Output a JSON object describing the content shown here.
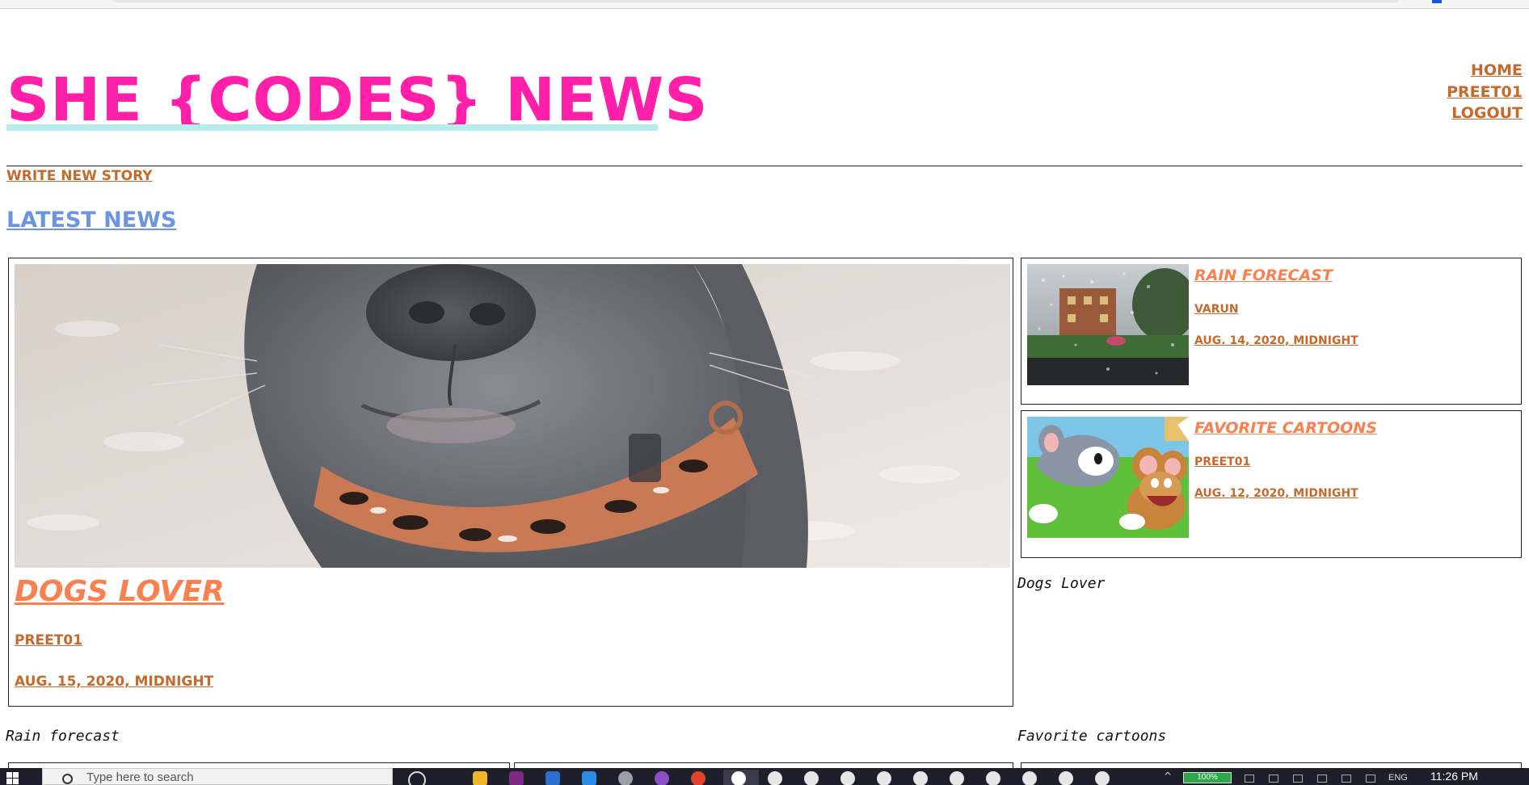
{
  "site": {
    "title": "SHE {CODES} NEWS"
  },
  "nav": {
    "home": "HOME",
    "user": "PREET01",
    "logout": "LOGOUT"
  },
  "actions": {
    "write_story": "WRITE NEW STORY"
  },
  "latest": {
    "heading": "LATEST NEWS"
  },
  "featured": {
    "title": "DOGS LOVER",
    "author": "PREET01",
    "date": "AUG. 15, 2020, MIDNIGHT",
    "image_icon": "dog-photo"
  },
  "stories": [
    {
      "title": "RAIN FORECAST",
      "author": "VARUN",
      "date": "AUG. 14, 2020, MIDNIGHT",
      "image_icon": "rain-window-photo"
    },
    {
      "title": "FAVORITE CARTOONS",
      "author": "PREET01",
      "date": "AUG. 12, 2020, MIDNIGHT",
      "image_icon": "tom-and-jerry-image"
    }
  ],
  "captions": {
    "dogs": "Dogs Lover",
    "rain": "Rain forecast",
    "cartoons": "Favorite cartoons"
  },
  "taskbar": {
    "search_placeholder": "Type here to search",
    "time": "11:26 PM",
    "language": "ENG",
    "battery_label": "100%"
  },
  "colors": {
    "brand_pink": "#ff1fa8",
    "title_highlight": "#b8ecec",
    "link_orange": "#c5692c",
    "story_title_coral": "#f98150",
    "latest_blue": "#6d94e3"
  }
}
